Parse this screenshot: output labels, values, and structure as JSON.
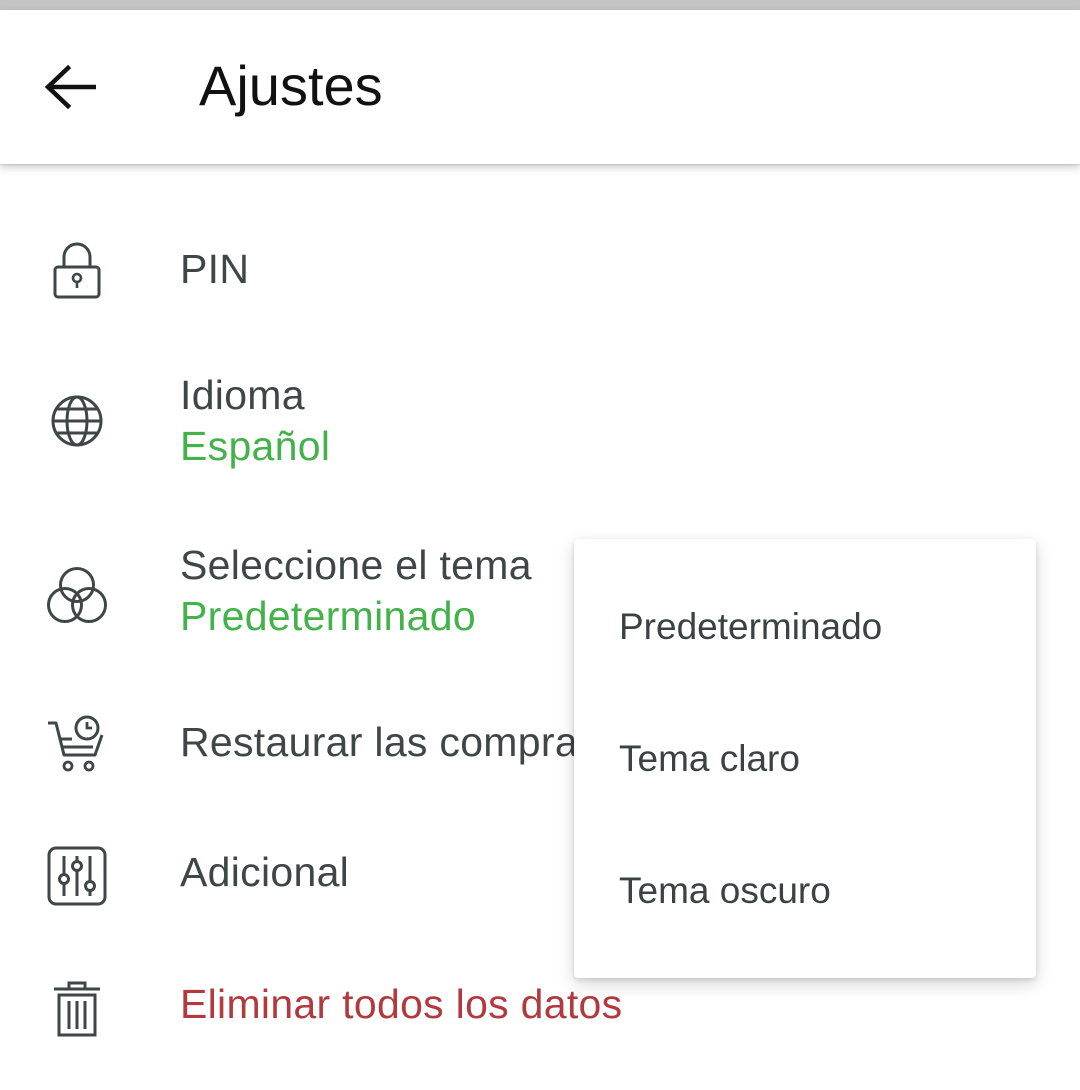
{
  "app_bar": {
    "title": "Ajustes",
    "back_icon": "arrow-left-icon"
  },
  "settings": [
    {
      "id": "pin",
      "icon": "lock-icon",
      "label": "PIN"
    },
    {
      "id": "language",
      "icon": "globe-icon",
      "label": "Idioma",
      "value": "Español"
    },
    {
      "id": "theme",
      "icon": "circles-icon",
      "label": "Seleccione el tema",
      "value": "Predeterminado"
    },
    {
      "id": "restore",
      "icon": "cart-clock-icon",
      "label": "Restaurar las compras"
    },
    {
      "id": "additional",
      "icon": "sliders-icon",
      "label": "Adicional"
    },
    {
      "id": "delete",
      "icon": "trash-icon",
      "label": "Eliminar todos los datos"
    }
  ],
  "theme_menu": {
    "options": [
      "Predeterminado",
      "Tema claro",
      "Tema oscuro"
    ]
  },
  "colors": {
    "accent_green": "#43b24a",
    "danger_red": "#b23a3f",
    "text": "#3f4648"
  }
}
